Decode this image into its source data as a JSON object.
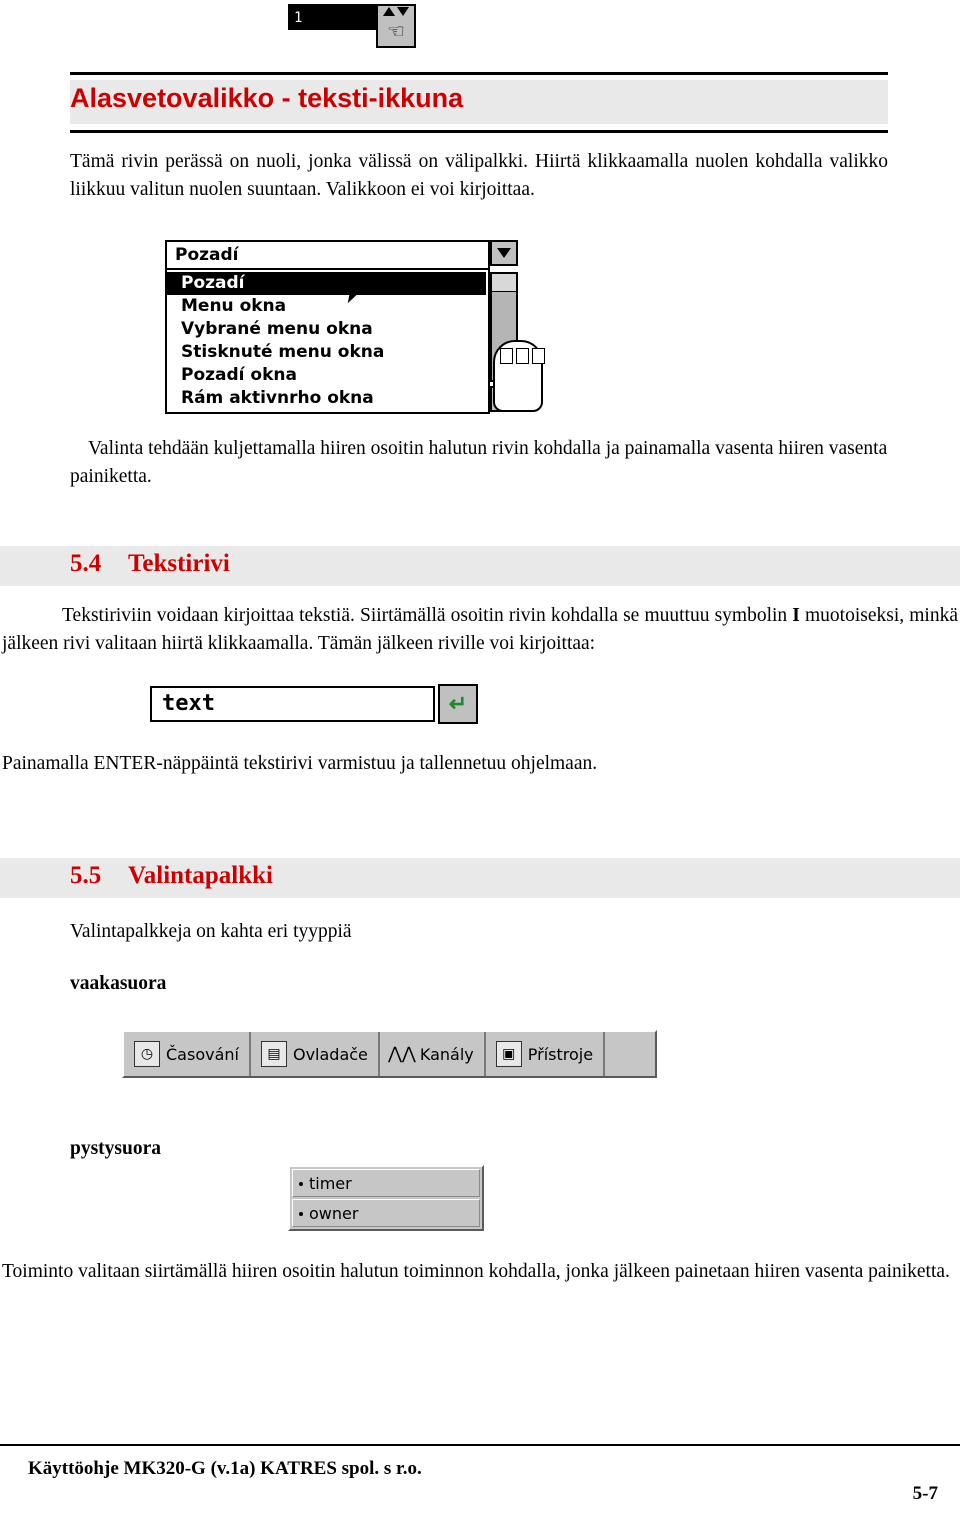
{
  "top_widget": {
    "field_value": "1",
    "up_icon": "arrow-up-icon",
    "down_icon": "arrow-down-icon",
    "cursor_icon": "hand-cursor-icon"
  },
  "heading1": "Alasvetovalikko - teksti-ikkuna",
  "paragraph1": "Tämä rivin perässä on nuoli, jonka välissä on välipalkki.  Hiirtä klikkaamalla nuolen kohdalla valikko liikkuu valitun nuolen suuntaan.  Valikkoon ei voi kirjoittaa.",
  "dropdown_figure": {
    "header_label": "Pozadí",
    "items": [
      "Pozadí",
      "Menu okna",
      "Vybrané menu okna",
      "Stisknuté menu okna",
      "Pozadí okna",
      "Rám aktivnrho okna"
    ],
    "selected_index": 0,
    "up_icon": "scroll-up-icon",
    "down_icon": "scroll-down-icon",
    "pointer_icon": "mouse-pointer-icon",
    "mouse_icon": "mouse-device-icon"
  },
  "paragraph2": "Valinta tehdään kuljettamalla hiiren osoitin halutun rivin kohdalla ja painamalla vasenta hiiren vasenta painiketta.",
  "section54": {
    "number": "5.4",
    "title": "Tekstirivi"
  },
  "paragraph3_part1": "Tekstiriviin voidaan kirjoittaa tekstiä.  Siirtämällä osoitin rivin kohdalla se muuttuu symbolin ",
  "paragraph3_bold": "I",
  "paragraph3_part2": " muotoiseksi, minkä jälkeen rivi valitaan hiirtä klikkaamalla.  Tämän jälkeen riville voi kirjoittaa:",
  "text_figure": {
    "value": "text",
    "button_icon": "enter-key-icon",
    "button_glyph": "↵"
  },
  "paragraph4": "Painamalla ENTER-näppäintä tekstirivi varmistuu ja tallennetuu ohjelmaan.",
  "section55": {
    "number": "5.5",
    "title": "Valintapalkki"
  },
  "paragraph5": "Valintapalkkeja on kahta eri tyyppiä",
  "label_horizontal": "vaakasuora",
  "horizontal_toolbar": {
    "items": [
      {
        "label": "Časování",
        "icon": "clock-icon",
        "glyph": "🕐"
      },
      {
        "label": "Ovladače",
        "icon": "controller-icon",
        "glyph": "▤"
      },
      {
        "label": "Kanály",
        "icon": "channels-icon",
        "glyph": "ᨈ"
      },
      {
        "label": "Přístroje",
        "icon": "devices-icon",
        "glyph": "▣"
      }
    ]
  },
  "label_vertical": "pystysuora",
  "vertical_toolbar": {
    "items": [
      "timer",
      "owner"
    ]
  },
  "paragraph6": "Toiminto valitaan siirtämällä hiiren osoitin halutun toiminnon kohdalla, jonka jälkeen painetaan hiiren vasenta painiketta.",
  "footer": {
    "left": "Käyttöohje  MK320-G (v.1a)  KATRES spol. s r.o.",
    "page": "5-7"
  },
  "colors": {
    "heading_red": "#cc0000",
    "heading_band": "#e9e9e9",
    "enter_green": "#1d8b2a"
  }
}
